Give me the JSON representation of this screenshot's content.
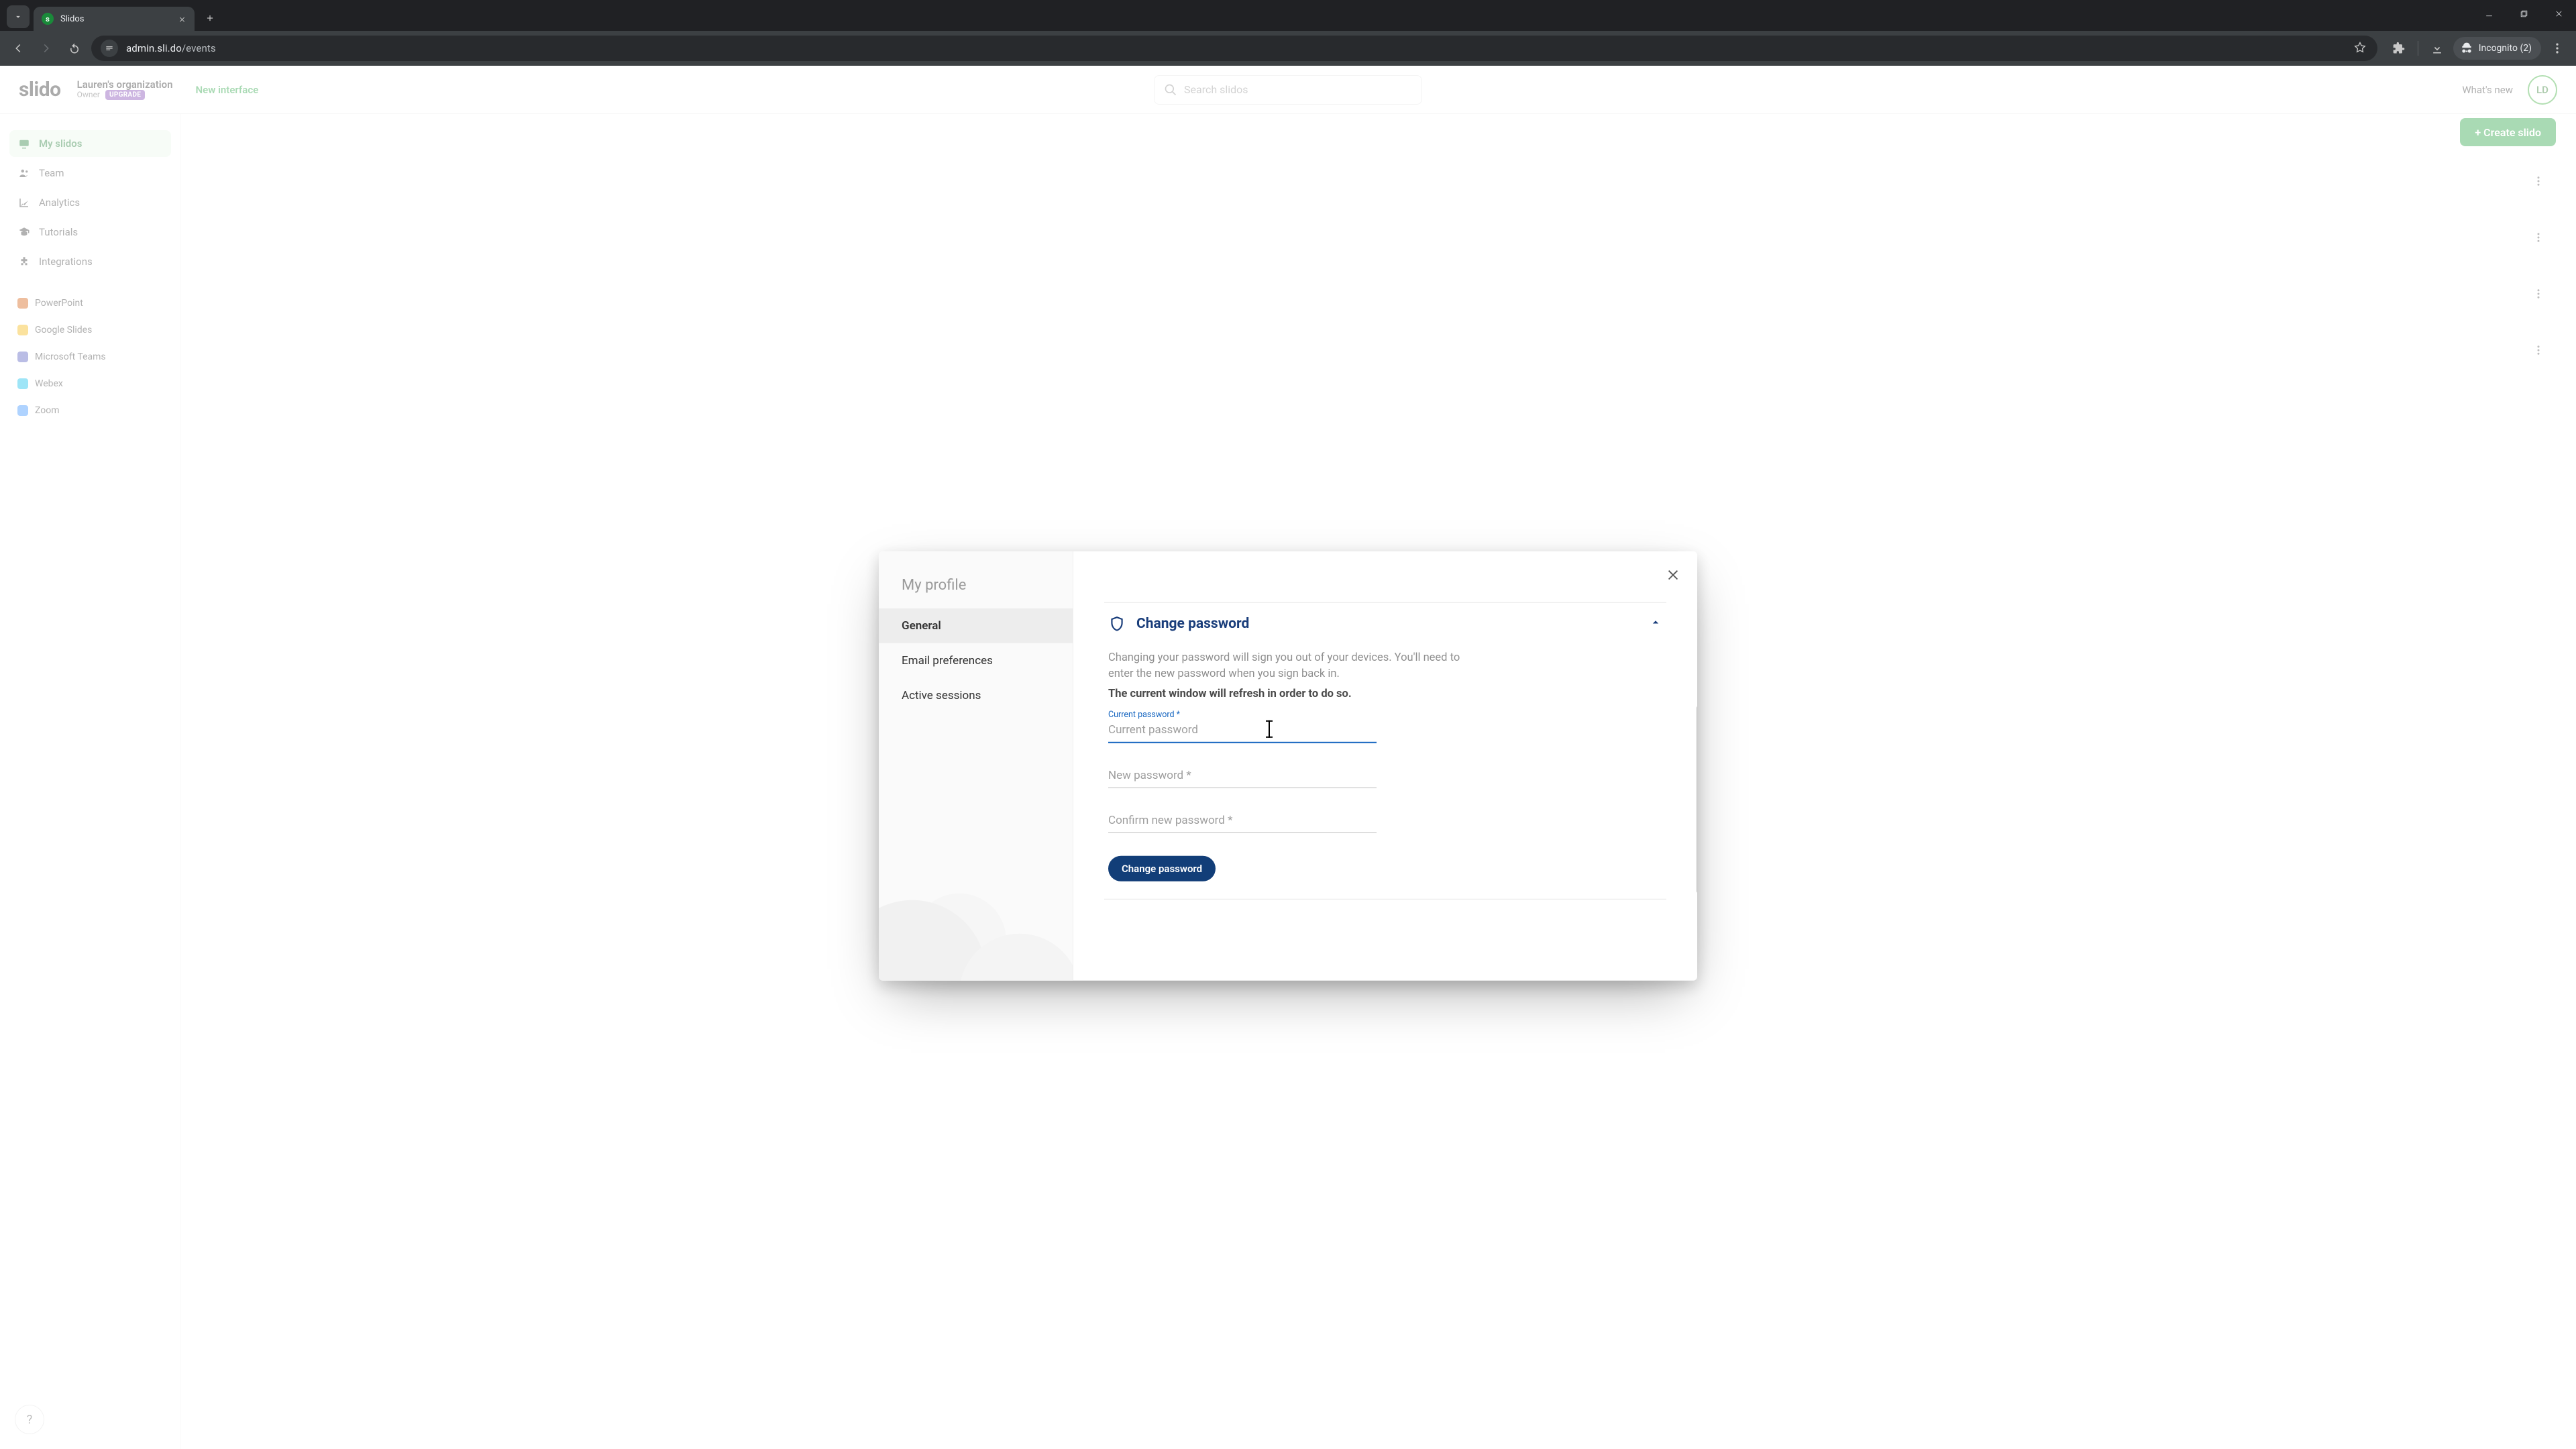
{
  "browser": {
    "tab_title": "Slidos",
    "url_host": "admin.sli.do",
    "url_path": "/events",
    "incognito_label": "Incognito (2)"
  },
  "header": {
    "logo_text": "slido",
    "org_name": "Lauren's organization",
    "role": "Owner",
    "upgrade": "UPGRADE",
    "new_interface": "New interface",
    "search_placeholder": "Search slidos",
    "whats_new": "What's new",
    "avatar_initials": "LD"
  },
  "sidebar": {
    "items": [
      {
        "label": "My slidos"
      },
      {
        "label": "Team"
      },
      {
        "label": "Analytics"
      },
      {
        "label": "Tutorials"
      },
      {
        "label": "Integrations"
      }
    ],
    "integrations": [
      {
        "label": "PowerPoint"
      },
      {
        "label": "Google Slides"
      },
      {
        "label": "Microsoft Teams"
      },
      {
        "label": "Webex"
      },
      {
        "label": "Zoom"
      }
    ],
    "help": "?"
  },
  "content": {
    "create_label": "+ Create slido"
  },
  "modal": {
    "title": "My profile",
    "nav": [
      {
        "label": "General"
      },
      {
        "label": "Email preferences"
      },
      {
        "label": "Active sessions"
      }
    ],
    "section": {
      "title": "Change password",
      "hint": "Changing your password will sign you out of your devices. You'll need to enter the new password when you sign back in.",
      "hint_strong": "The current window will refresh in order to do so.",
      "fields": {
        "current": {
          "label": "Current password *",
          "placeholder": "Current password"
        },
        "newpw": {
          "placeholder": "New password *"
        },
        "confirm": {
          "placeholder": "Confirm new password *"
        }
      },
      "submit": "Change password"
    }
  }
}
